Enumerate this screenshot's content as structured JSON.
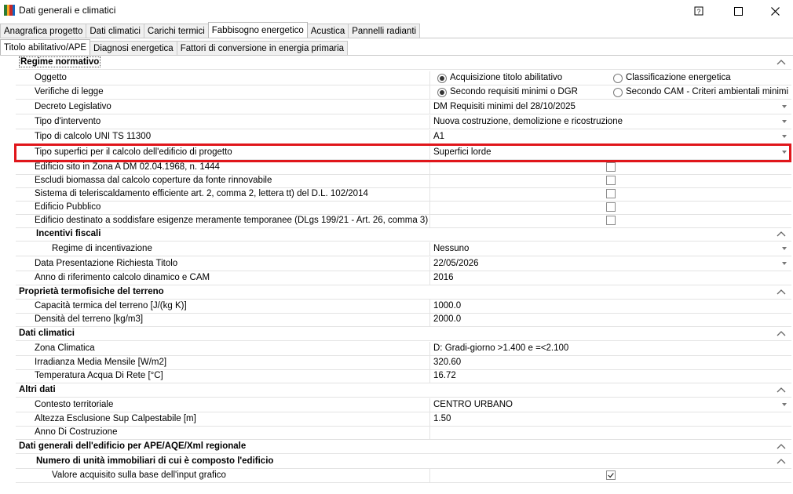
{
  "window": {
    "title": "Dati generali e climatici"
  },
  "main_tabs": [
    "Anagrafica progetto",
    "Dati climatici",
    "Carichi termici",
    "Fabbisogno energetico",
    "Acustica",
    "Pannelli radianti"
  ],
  "sub_tabs": [
    "Titolo abilitativo/APE",
    "Diagnosi energetica",
    "Fattori di conversione in energia primaria"
  ],
  "rows": [
    {
      "kind": "cat",
      "label": "Regime normativo"
    },
    {
      "kind": "radio",
      "label": "Oggetto",
      "opt1": "Acquisizione titolo abilitativo",
      "opt2": "Classificazione energetica"
    },
    {
      "kind": "radio",
      "label": "Verifiche di legge",
      "opt1": "Secondo requisiti minimi o DGR",
      "opt2": "Secondo CAM - Criteri ambientali minimi"
    },
    {
      "kind": "dd",
      "label": "Decreto Legislativo",
      "value": "DM Requisiti minimi del 28/10/2025"
    },
    {
      "kind": "dd",
      "label": "Tipo d'intervento",
      "value": "Nuova costruzione, demolizione e ricostruzione"
    },
    {
      "kind": "dd",
      "label": "Tipo di calcolo UNI TS 11300",
      "value": "A1"
    },
    {
      "kind": "dd",
      "label": "Tipo superfici per il calcolo dell'edificio di progetto",
      "value": "Superfici lorde"
    },
    {
      "kind": "cb",
      "label": "Edificio sito in Zona A DM 02.04.1968, n. 1444",
      "checked": false
    },
    {
      "kind": "cb",
      "label": "Escludi biomassa dal calcolo coperture da fonte rinnovabile",
      "checked": false
    },
    {
      "kind": "cb",
      "label": "Sistema di teleriscaldamento efficiente art. 2, comma 2, lettera tt) del D.L. 102/2014",
      "checked": false
    },
    {
      "kind": "cb",
      "label": "Edificio Pubblico",
      "checked": false
    },
    {
      "kind": "cb",
      "label": "Edificio destinato a soddisfare esigenze meramente temporanee (DLgs 199/21 - Art. 26, comma 3)",
      "checked": false
    },
    {
      "kind": "subcat",
      "label": "Incentivi fiscali"
    },
    {
      "kind": "dd",
      "label": "Regime di incentivazione",
      "value": "Nessuno",
      "indent": 2
    },
    {
      "kind": "dd",
      "label": "Data Presentazione Richiesta Titolo",
      "value": "22/05/2026"
    },
    {
      "kind": "text",
      "label": "Anno di riferimento calcolo dinamico e CAM",
      "value": "2016"
    },
    {
      "kind": "cat",
      "label": "Proprietà termofisiche del terreno"
    },
    {
      "kind": "text",
      "label": "Capacità termica del terreno [J/(kg K)]",
      "value": "1000.0"
    },
    {
      "kind": "text",
      "label": "Densità del terreno [kg/m3]",
      "value": "2000.0"
    },
    {
      "kind": "cat",
      "label": "Dati climatici"
    },
    {
      "kind": "text",
      "label": "Zona Climatica",
      "value": "D: Gradi-giorno >1.400 e  =<2.100"
    },
    {
      "kind": "text",
      "label": "Irradianza Media Mensile [W/m2]",
      "value": "320.60"
    },
    {
      "kind": "text",
      "label": "Temperatura Acqua Di Rete [°C]",
      "value": "16.72"
    },
    {
      "kind": "cat",
      "label": "Altri dati"
    },
    {
      "kind": "dd",
      "label": "Contesto territoriale",
      "value": "CENTRO URBANO"
    },
    {
      "kind": "text",
      "label": "Altezza Esclusione Sup Calpestabile [m]",
      "value": "1.50"
    },
    {
      "kind": "text",
      "label": "Anno Di Costruzione",
      "value": ""
    },
    {
      "kind": "cat",
      "label": "Dati generali dell'edificio per APE/AQE/Xml regionale"
    },
    {
      "kind": "subcat",
      "label": "Numero di unità immobiliari di cui è composto l'edificio"
    },
    {
      "kind": "cb",
      "label": "Valore acquisito sulla base dell'input grafico",
      "checked": true,
      "indent": 2
    }
  ]
}
